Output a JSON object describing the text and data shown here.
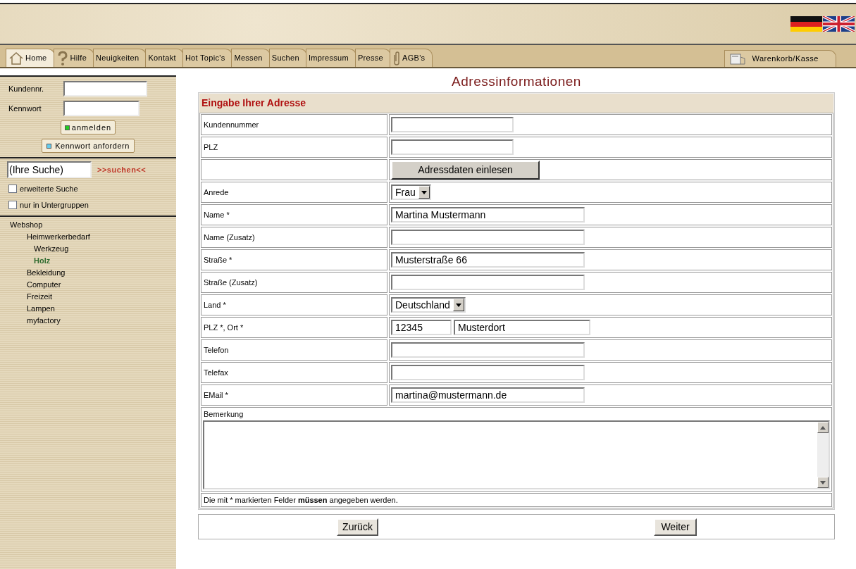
{
  "tabs": [
    {
      "label": "Home",
      "selected": true
    },
    {
      "label": "Hilfe",
      "selected": false
    },
    {
      "label": "Neuigkeiten",
      "selected": false
    },
    {
      "label": "Kontakt",
      "selected": false
    },
    {
      "label": "Hot Topic's",
      "selected": false
    },
    {
      "label": "Messen",
      "selected": false
    },
    {
      "label": "Suchen",
      "selected": false
    },
    {
      "label": "Impressum",
      "selected": false
    },
    {
      "label": "Presse",
      "selected": false
    },
    {
      "label": "AGB's",
      "selected": false
    }
  ],
  "cart_tab": {
    "label": "Warenkorb/Kasse"
  },
  "login": {
    "customer_label": "Kundennr.",
    "password_label": "Kennwort",
    "login_button": "anmelden",
    "request_button": "Kennwort anfordern"
  },
  "search": {
    "value": "(Ihre Suche)",
    "link": ">>suchen<<",
    "options": [
      {
        "label": "erweiterte Suche",
        "checked": false
      },
      {
        "label": "nur in Untergruppen",
        "checked": false
      }
    ]
  },
  "tree": [
    {
      "label": "Webshop",
      "selected": false,
      "children": [
        {
          "label": "Heimwerkerbedarf",
          "selected": false,
          "children": [
            {
              "label": "Werkzeug",
              "selected": false
            },
            {
              "label": "Holz",
              "selected": true
            }
          ]
        },
        {
          "label": "Bekleidung",
          "selected": false
        },
        {
          "label": "Computer",
          "selected": false
        },
        {
          "label": "Freizeit",
          "selected": false
        },
        {
          "label": "Lampen",
          "selected": false
        },
        {
          "label": "myfactory",
          "selected": false
        }
      ]
    }
  ],
  "page_title": "Adressinformationen",
  "form": {
    "title": "Eingabe Ihrer Adresse",
    "rows": [
      {
        "kind": "short",
        "label": "Kundennummer",
        "value": ""
      },
      {
        "kind": "short",
        "label": "PLZ",
        "value": ""
      },
      {
        "kind": "button",
        "button": "Adressdaten einlesen"
      },
      {
        "kind": "select",
        "label": "Anrede",
        "value": "Frau"
      },
      {
        "kind": "text",
        "label": "Name *",
        "value": "Martina Mustermann"
      },
      {
        "kind": "text",
        "label": "Name (Zusatz)",
        "value": ""
      },
      {
        "kind": "text",
        "label": "Straße *",
        "value": "Musterstraße 66"
      },
      {
        "kind": "text",
        "label": "Straße (Zusatz)",
        "value": ""
      },
      {
        "kind": "select",
        "label": "Land *",
        "value": "Deutschland"
      },
      {
        "kind": "postal",
        "label": "PLZ *, Ort *",
        "value": "12345",
        "value2": "Musterdort"
      },
      {
        "kind": "text",
        "label": "Telefon",
        "value": ""
      },
      {
        "kind": "text",
        "label": "Telefax",
        "value": ""
      },
      {
        "kind": "text",
        "label": "EMail *",
        "value": "martina@mustermann.de"
      }
    ],
    "remark_label": "Bemerkung",
    "note": "Die mit * markierten Felder **müssen** angegeben werden.",
    "back_button": "Zurück",
    "next_button": "Weiter"
  }
}
